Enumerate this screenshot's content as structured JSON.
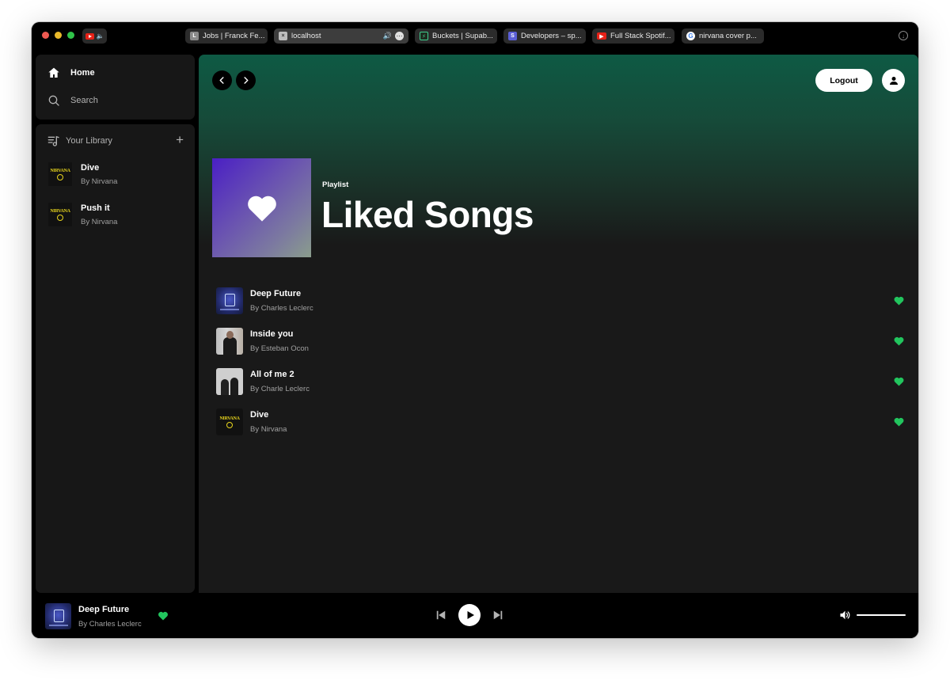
{
  "browser": {
    "pinned_tab": {
      "icon": "youtube-icon",
      "muted": true
    },
    "tabs": [
      {
        "label": "Jobs | Franck Fe...",
        "icon": "L",
        "active": false
      },
      {
        "label": "localhost",
        "icon": "localhost-icon",
        "active": true,
        "playing_audio": true
      },
      {
        "label": "Buckets | Supab...",
        "icon": "supabase-icon",
        "active": false
      },
      {
        "label": "Developers – sp...",
        "icon": "S",
        "active": false
      },
      {
        "label": "Full Stack Spotif...",
        "icon": "youtube-icon",
        "active": false
      },
      {
        "label": "nirvana cover p...",
        "icon": "G",
        "active": false
      }
    ]
  },
  "sidebar": {
    "nav": [
      {
        "label": "Home",
        "icon": "home-icon",
        "active": true
      },
      {
        "label": "Search",
        "icon": "search-icon",
        "active": false
      }
    ],
    "library": {
      "title": "Your Library",
      "add_label": "+",
      "items": [
        {
          "title": "Dive",
          "subtitle": "By Nirvana",
          "cover_text": "NIRVANA"
        },
        {
          "title": "Push it",
          "subtitle": "By Nirvana",
          "cover_text": "NIRVANA"
        }
      ]
    }
  },
  "header": {
    "logout_label": "Logout"
  },
  "playlist": {
    "type_label": "Playlist",
    "title": "Liked Songs",
    "songs": [
      {
        "title": "Deep Future",
        "artist": "By Charles Leclerc",
        "liked": true
      },
      {
        "title": "Inside you",
        "artist": "By Esteban Ocon",
        "liked": true
      },
      {
        "title": "All of me 2",
        "artist": "By Charle Leclerc",
        "liked": true
      },
      {
        "title": "Dive",
        "artist": "By Nirvana",
        "liked": true,
        "cover_text": "NIRVANA"
      }
    ]
  },
  "player": {
    "now_playing": {
      "title": "Deep Future",
      "artist": "By Charles Leclerc",
      "liked": true
    },
    "is_playing": false,
    "volume": 1.0
  },
  "colors": {
    "accent_green": "#22c55e",
    "background": "#191919",
    "sidebar_bg": "#171717",
    "header_gradient_top": "#0e5a44"
  }
}
